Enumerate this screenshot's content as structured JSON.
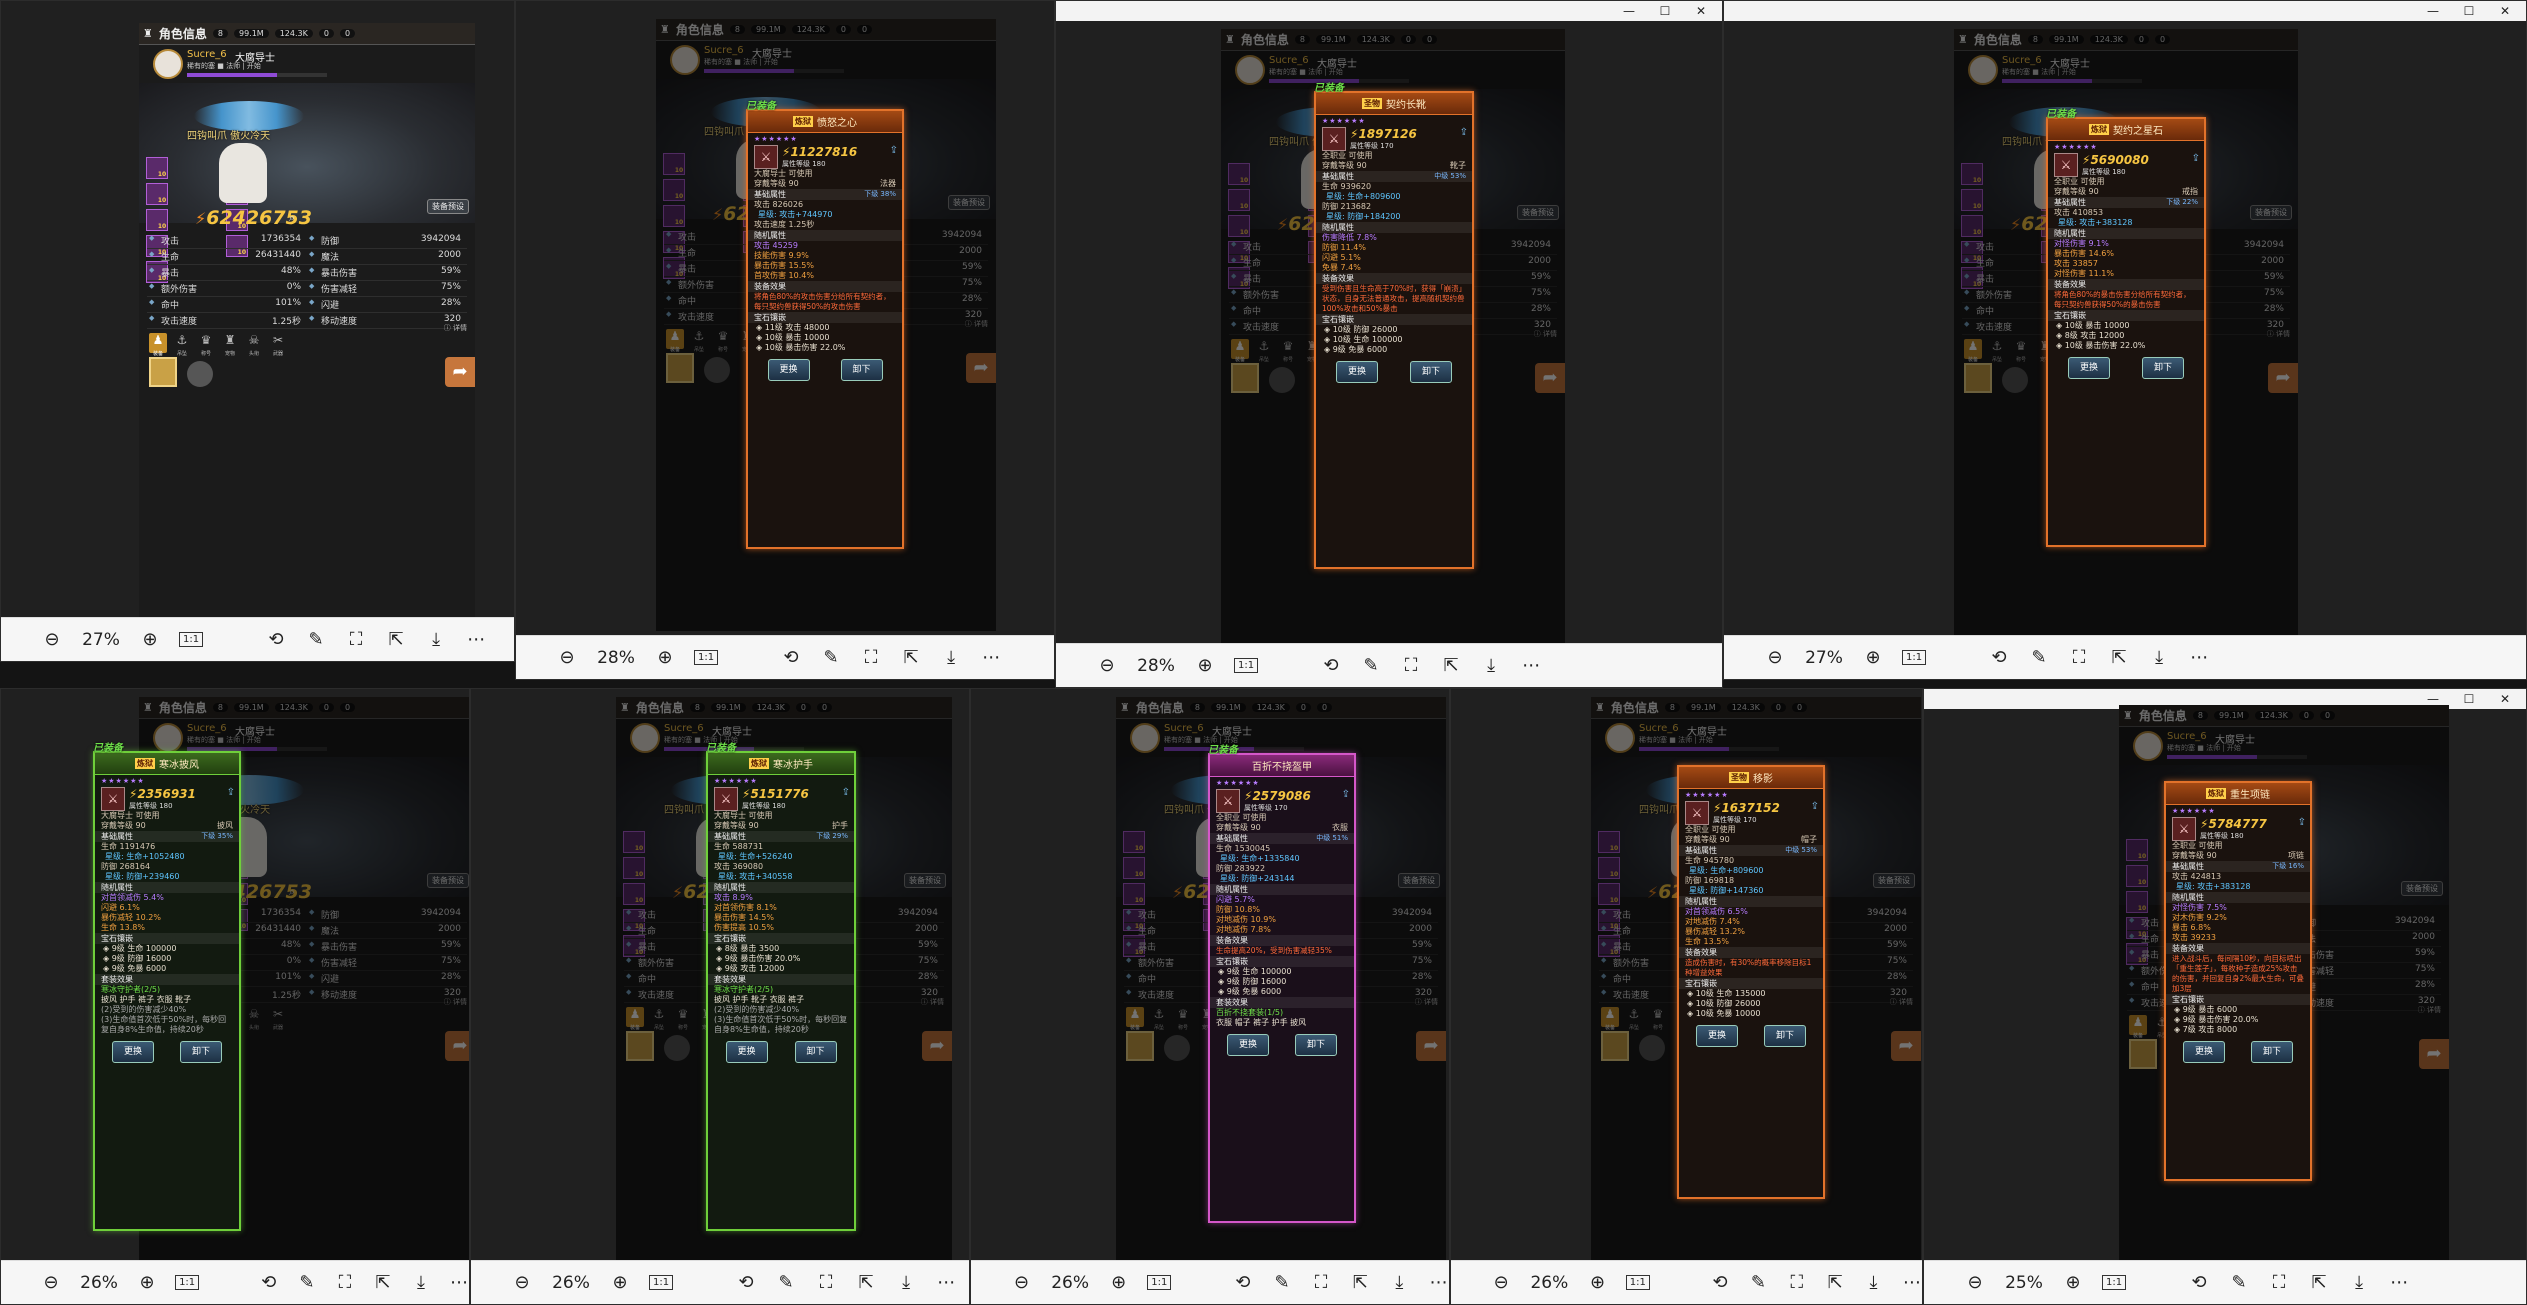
{
  "viewers": [
    {
      "zoom": "27%",
      "reset": "1:1"
    },
    {
      "zoom": "28%",
      "reset": "1:1"
    },
    {
      "zoom": "28%",
      "reset": "1:1"
    },
    {
      "zoom": "27%",
      "reset": "1:1"
    },
    {
      "zoom": "26%",
      "reset": "1:1"
    },
    {
      "zoom": "26%",
      "reset": "1:1"
    },
    {
      "zoom": "26%",
      "reset": "1:1"
    },
    {
      "zoom": "26%",
      "reset": "1:1"
    },
    {
      "zoom": "25%",
      "reset": "1:1"
    }
  ],
  "game": {
    "header_title": "角色信息",
    "header_badge": "8",
    "currency1": "99.1M",
    "currency2": "124.3K",
    "currency3": "0",
    "currency4": "0",
    "player_name": "Sucre_6",
    "player_title": "大腐导士",
    "player_sub": "稀有的塞 ■ 法师 | 开始",
    "level": "等级 90",
    "hero_label": "四钩叫爪 傲火冷天",
    "preset_label": "装备预设",
    "combat_power": "62426753",
    "stats": [
      [
        {
          "k": "攻击",
          "v": "1736354"
        },
        {
          "k": "防御",
          "v": "3942094"
        }
      ],
      [
        {
          "k": "生命",
          "v": "26431440"
        },
        {
          "k": "魔法",
          "v": "2000"
        }
      ],
      [
        {
          "k": "暴击",
          "v": "48%"
        },
        {
          "k": "暴击伤害",
          "v": "59%"
        }
      ],
      [
        {
          "k": "额外伤害",
          "v": "0%"
        },
        {
          "k": "伤害减轻",
          "v": "75%"
        }
      ],
      [
        {
          "k": "命中",
          "v": "101%"
        },
        {
          "k": "闪避",
          "v": "28%"
        }
      ],
      [
        {
          "k": "攻击速度",
          "v": "1.25秒"
        },
        {
          "k": "移动速度",
          "v": "320"
        }
      ]
    ],
    "detail_label": "详情",
    "tabs": [
      "装备",
      "吊坠",
      "称号",
      "宠物",
      "头衔",
      "武器"
    ]
  },
  "cards": [
    {
      "equipped": "已装备",
      "badge": "炼狱",
      "name": "愤怒之心",
      "stars": "★★★★★★",
      "power": "11227816",
      "item_level": "属性等级 180",
      "usable": "大腐导士 可使用",
      "wear": "穿戴等级 90",
      "slot": "法器",
      "base_title": "基础属性",
      "base_next": "下级 38%",
      "base": [
        {
          "t": "攻击 826026",
          "b": "星级: 攻击+744970"
        },
        {
          "t": "攻击速度 1.25秒",
          "b": ""
        }
      ],
      "rand_title": "随机属性",
      "rand": [
        "攻击 45259",
        "技能伤害 9.9%",
        "暴击伤害 15.5%",
        "首攻伤害 10.4%"
      ],
      "eff_title": "装备效果",
      "eff": "将角色80%的攻击伤害分给所有契约者，每只契约兽获得50%的攻击伤害",
      "gem_title": "宝石镶嵌",
      "gems": [
        "11级 攻击 48000",
        "10级 暴击 10000",
        "10级 暴击伤害 22.0%"
      ],
      "set_title": "",
      "set": [],
      "btn1": "更换",
      "btn2": "卸下"
    },
    {
      "equipped": "已装备",
      "badge": "圣物",
      "name": "契约长靴",
      "stars": "★★★★★★",
      "power": "1897126",
      "item_level": "属性等级 170",
      "usable": "全职业 可使用",
      "wear": "穿戴等级 90",
      "slot": "靴子",
      "base_title": "基础属性",
      "base_next": "中级 53%",
      "base": [
        {
          "t": "生命 939620",
          "b": "星级: 生命+809600"
        },
        {
          "t": "防御 213682",
          "b": "星级: 防御+184200"
        }
      ],
      "rand_title": "随机属性",
      "rand": [
        "伤害降低 7.8%",
        "防御 11.4%",
        "闪避 5.1%",
        "免暴 7.4%"
      ],
      "eff_title": "装备效果",
      "eff": "受到伤害且生命高于70%时，获得「崩溃」状态，自身无法普通攻击，提高随机契约兽100%攻击和50%暴击",
      "gem_title": "宝石镶嵌",
      "gems": [
        "10级 防御 26000",
        "10级 生命 100000",
        "9级 免暴 6000"
      ],
      "set_title": "",
      "set": [],
      "btn1": "更换",
      "btn2": "卸下"
    },
    {
      "equipped": "已装备",
      "badge": "炼狱",
      "name": "契约之星石",
      "stars": "★★★★★★",
      "power": "5690080",
      "item_level": "属性等级 180",
      "usable": "全职业 可使用",
      "wear": "穿戴等级 90",
      "slot": "戒指",
      "base_title": "基础属性",
      "base_next": "下级 22%",
      "base": [
        {
          "t": "攻击 410853",
          "b": "星级: 攻击+383128"
        }
      ],
      "rand_title": "随机属性",
      "rand": [
        "对怪伤害 9.1%",
        "暴击伤害 14.6%",
        "攻击 33857",
        "对怪伤害 11.1%"
      ],
      "eff_title": "装备效果",
      "eff": "将角色80%的暴击伤害分给所有契约者，每只契约兽获得50%的暴击伤害",
      "gem_title": "宝石镶嵌",
      "gems": [
        "10级 暴击 10000",
        "8级 攻击 12000",
        "10级 暴击伤害 22.0%"
      ],
      "set_title": "",
      "set": [],
      "btn1": "更换",
      "btn2": "卸下"
    },
    {
      "equipped": "已装备",
      "badge": "炼狱",
      "name": "寒冰披风",
      "stars": "★★★★★★",
      "power": "2356931",
      "item_level": "属性等级 180",
      "usable": "大腐导士 可使用",
      "wear": "穿戴等级 90",
      "slot": "披风",
      "base_title": "基础属性",
      "base_next": "下级 35%",
      "base": [
        {
          "t": "生命 1191476",
          "b": "星级: 生命+1052480"
        },
        {
          "t": "防御 268164",
          "b": "星级: 防御+239460"
        }
      ],
      "rand_title": "随机属性",
      "rand": [
        "对首领减伤 5.4%",
        "闪避 6.1%",
        "暴伤减轻 10.2%",
        "生命 13.8%"
      ],
      "eff_title": "",
      "eff": "",
      "gem_title": "宝石镶嵌",
      "gems": [
        "9级 生命 100000",
        "9级 防御 16000",
        "9级 免暴 6000"
      ],
      "set_title": "套装效果",
      "set": [
        "寒冰守护者(2/5)",
        "披风 护手 裤子 衣服 靴子",
        "(2)受到的伤害减少40%",
        "(3)生命值首次低于50%时，每秒回复自身8%生命值，持续20秒"
      ],
      "btn1": "更换",
      "btn2": "卸下"
    },
    {
      "equipped": "已装备",
      "badge": "炼狱",
      "name": "寒冰护手",
      "stars": "★★★★★★",
      "power": "5151776",
      "item_level": "属性等级 180",
      "usable": "大腐导士 可使用",
      "wear": "穿戴等级 90",
      "slot": "护手",
      "base_title": "基础属性",
      "base_next": "下级 29%",
      "base": [
        {
          "t": "生命 588731",
          "b": "星级: 生命+526240"
        },
        {
          "t": "攻击 369080",
          "b": "星级: 攻击+340558"
        }
      ],
      "rand_title": "随机属性",
      "rand": [
        "攻击 8.9%",
        "对首领伤害 8.1%",
        "暴击伤害 14.5%",
        "伤害提高 10.5%"
      ],
      "eff_title": "",
      "eff": "",
      "gem_title": "宝石镶嵌",
      "gems": [
        "8级 暴击 3500",
        "9级 暴击伤害 20.0%",
        "9级 攻击 12000"
      ],
      "set_title": "套装效果",
      "set": [
        "寒冰守护者(2/5)",
        "披风 护手 靴子 衣服 裤子",
        "(2)受到的伤害减少40%",
        "(3)生命值首次低于50%时，每秒回复自身8%生命值，持续20秒"
      ],
      "btn1": "更换",
      "btn2": "卸下"
    },
    {
      "equipped": "已装备",
      "badge": "",
      "name": "百折不挠盔甲",
      "stars": "★★★★★★",
      "power": "2579086",
      "item_level": "属性等级 170",
      "usable": "全职业 可使用",
      "wear": "穿戴等级 90",
      "slot": "衣服",
      "base_title": "基础属性",
      "base_next": "中级 51%",
      "base": [
        {
          "t": "生命 1530045",
          "b": "星级: 生命+1335840"
        },
        {
          "t": "防御 283922",
          "b": "星级: 防御+243144"
        }
      ],
      "rand_title": "随机属性",
      "rand": [
        "闪避 5.7%",
        "防御 10.8%",
        "对地减伤 10.9%",
        "对地减伤 7.8%"
      ],
      "eff_title": "装备效果",
      "eff": "生命提高20%，受到伤害减轻35%",
      "gem_title": "宝石镶嵌",
      "gems": [
        "9级 生命 100000",
        "9级 防御 16000",
        "9级 免暴 6000"
      ],
      "set_title": "套装效果",
      "set": [
        "百折不挠套装(1/5)",
        "衣服 帽子 裤子 护手 披风"
      ],
      "btn1": "更换",
      "btn2": "卸下"
    },
    {
      "equipped": "",
      "badge": "圣物",
      "name": "移影",
      "stars": "★★★★★★",
      "power": "1637152",
      "item_level": "属性等级 170",
      "usable": "全职业 可使用",
      "wear": "穿戴等级 90",
      "slot": "帽子",
      "base_title": "基础属性",
      "base_next": "中级 53%",
      "base": [
        {
          "t": "生命 945780",
          "b": "星级: 生命+809600"
        },
        {
          "t": "防御 169818",
          "b": "星级: 防御+147360"
        }
      ],
      "rand_title": "随机属性",
      "rand": [
        "对首领减伤 6.5%",
        "对地减伤 7.4%",
        "暴伤减轻 13.2%",
        "生命 13.5%"
      ],
      "eff_title": "装备效果",
      "eff": "造成伤害时，有30%的概率移除目标1种增益效果",
      "gem_title": "宝石镶嵌",
      "gems": [
        "10级 生命 135000",
        "10级 防御 26000",
        "10级 免暴 10000"
      ],
      "set_title": "",
      "set": [],
      "btn1": "更换",
      "btn2": "卸下"
    },
    {
      "equipped": "",
      "badge": "炼狱",
      "name": "重生项链",
      "stars": "★★★★★★",
      "power": "5784777",
      "item_level": "属性等级 180",
      "usable": "全职业 可使用",
      "wear": "穿戴等级 90",
      "slot": "项链",
      "base_title": "基础属性",
      "base_next": "下级 16%",
      "base": [
        {
          "t": "攻击 424813",
          "b": "星级: 攻击+383128"
        }
      ],
      "rand_title": "随机属性",
      "rand": [
        "对怪伤害 7.5%",
        "对木伤害 9.2%",
        "暴击 6.8%",
        "攻击 39233"
      ],
      "eff_title": "装备效果",
      "eff": "进入战斗后，每间隔10秒，向目标喷出「重生莲子」，每枚种子造成25%攻击的伤害，并回复自身2%最大生命，可叠加3层",
      "gem_title": "宝石镶嵌",
      "gems": [
        "9级 暴击 6000",
        "9级 暴击伤害 20.0%",
        "7级 攻击 8000"
      ],
      "set_title": "",
      "set": [],
      "btn1": "更换",
      "btn2": "卸下"
    }
  ]
}
